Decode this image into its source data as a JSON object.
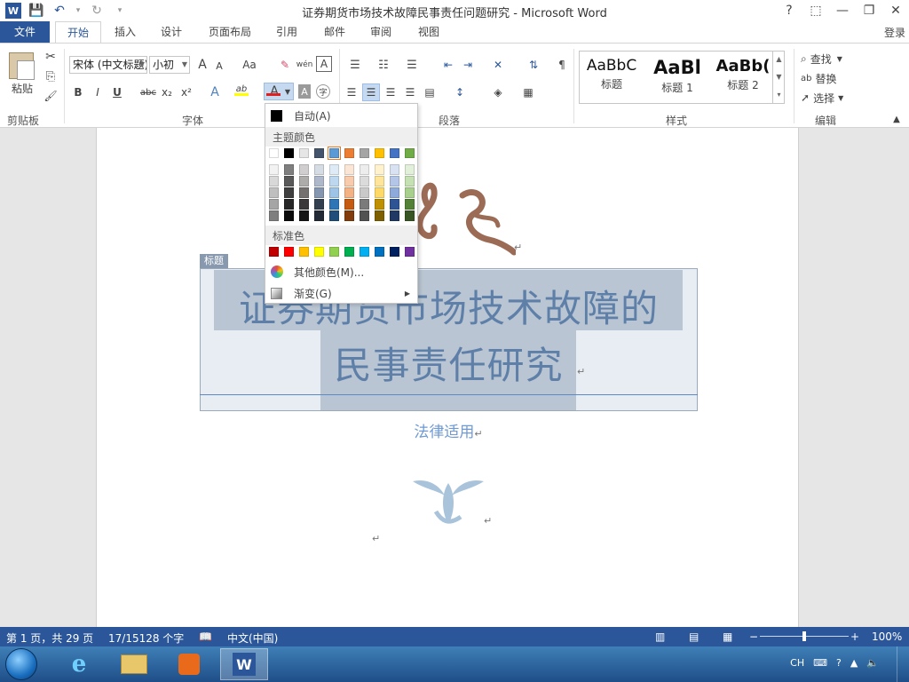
{
  "window": {
    "title": "证券期货市场技术故障民事责任问题研究 - Microsoft Word",
    "app_icon_label": "W",
    "help": "?",
    "restore_ribbon": "⬚",
    "minimize": "—",
    "maximize": "❐",
    "close": "✕"
  },
  "qat": {
    "save": "💾",
    "undo": "↶",
    "undo_arrow": "▾",
    "redo": "↻",
    "customize": "▾"
  },
  "tabs": [
    "文件",
    "开始",
    "插入",
    "设计",
    "页面布局",
    "引用",
    "邮件",
    "审阅",
    "视图"
  ],
  "active_tab": "开始",
  "login": "登录",
  "ribbon": {
    "clipboard": {
      "paste": "粘贴",
      "cut": "✂",
      "copy": "⎘",
      "format_painter": "🖌",
      "label": "剪贴板"
    },
    "font": {
      "font_name": "宋体 (中文标题)",
      "font_size": "小初",
      "grow": "A",
      "shrink": "A",
      "case": "Aa",
      "clear": "✎",
      "phonetic": "wén",
      "border_char": "A",
      "bold": "B",
      "italic": "I",
      "underline": "U",
      "strike": "abc",
      "sub": "x₂",
      "sup": "x²",
      "effects": "A",
      "highlight": "ab",
      "font_color": "A",
      "shading": "A",
      "enclose": "字",
      "label": "字体"
    },
    "paragraph": {
      "label": "段落"
    },
    "styles": {
      "items": [
        {
          "sample": "AaBbC",
          "name": "标题"
        },
        {
          "sample": "AaBl",
          "name": "标题 1"
        },
        {
          "sample": "AaBb(",
          "name": "标题 2"
        }
      ],
      "label": "样式"
    },
    "editing": {
      "find": "查找",
      "replace": "替换",
      "select": "选择",
      "label": "编辑"
    }
  },
  "font_color_menu": {
    "auto": "自动(A)",
    "theme_header": "主题颜色",
    "standard_header": "标准色",
    "more": "其他颜色(M)...",
    "gradient": "渐变(G)",
    "theme_top": [
      "#ffffff",
      "#000000",
      "#e7e6e6",
      "#44546a",
      "#5b9bd5",
      "#ed7d31",
      "#a5a5a5",
      "#ffc000",
      "#4472c4",
      "#70ad47"
    ],
    "theme_shades": [
      [
        "#f2f2f2",
        "#7f7f7f",
        "#d0cece",
        "#d6dce4",
        "#deebf6",
        "#fbe5d5",
        "#ededed",
        "#fff2cc",
        "#d9e2f3",
        "#e2efd9"
      ],
      [
        "#d8d8d8",
        "#595959",
        "#aeabab",
        "#adb9ca",
        "#bdd7ee",
        "#f7cbac",
        "#dbdbdb",
        "#fee599",
        "#b4c6e7",
        "#c5e0b3"
      ],
      [
        "#bfbfbf",
        "#3f3f3f",
        "#757070",
        "#8496b0",
        "#9dc3e6",
        "#f4b183",
        "#c9c9c9",
        "#ffd965",
        "#8eaadb",
        "#a8d08d"
      ],
      [
        "#a5a5a5",
        "#262626",
        "#3a3838",
        "#323f4f",
        "#2e75b5",
        "#c55a11",
        "#7b7b7b",
        "#bf9000",
        "#2f5496",
        "#538135"
      ],
      [
        "#7f7f7f",
        "#0c0c0c",
        "#171616",
        "#222a35",
        "#1e4e79",
        "#833c0b",
        "#525252",
        "#7f6000",
        "#1f3864",
        "#375623"
      ]
    ],
    "standard": [
      "#c00000",
      "#ff0000",
      "#ffc000",
      "#ffff00",
      "#92d050",
      "#00b050",
      "#00b0f0",
      "#0070c0",
      "#002060",
      "#7030a0"
    ]
  },
  "document": {
    "title_tag": "标题",
    "title_line1": "证券期货市场技术故障的",
    "title_line2": "民事责任研究",
    "subtitle": "法律适用",
    "para_mark": "↵"
  },
  "status": {
    "page": "第 1 页，共 29 页",
    "words": "17/15128 个字",
    "language": "中文(中国)",
    "zoom": "100%",
    "zoom_level": 0.5
  },
  "taskbar": {
    "tray_lang": "CH"
  }
}
